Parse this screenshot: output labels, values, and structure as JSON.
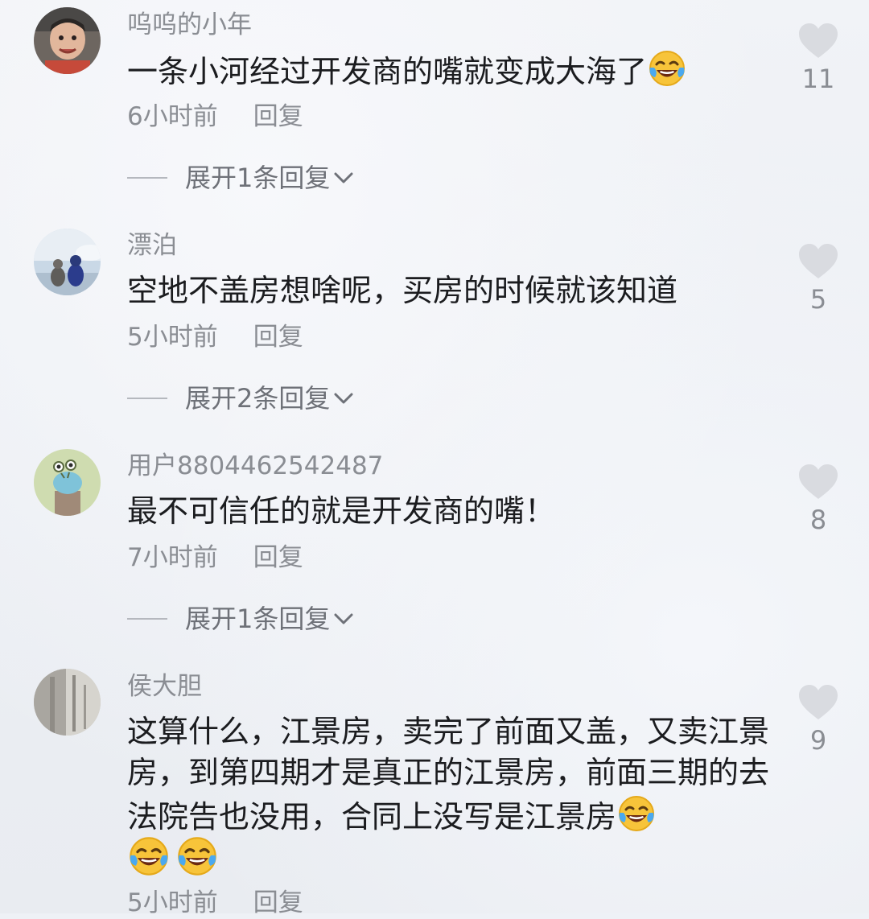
{
  "comments": [
    {
      "username": "呜呜的小年",
      "text": "一条小河经过开发商的嘴就变成大海了",
      "time": "6小时前",
      "reply_label": "回复",
      "expand_label": "展开1条回复",
      "likes": "11",
      "emoji_inline": "laugh-cry-icon"
    },
    {
      "username": "漂泊",
      "text": "空地不盖房想啥呢，买房的时候就该知道",
      "time": "5小时前",
      "reply_label": "回复",
      "expand_label": "展开2条回复",
      "likes": "5"
    },
    {
      "username": "用户8804462542487",
      "text": "最不可信任的就是开发商的嘴！",
      "time": "7小时前",
      "reply_label": "回复",
      "expand_label": "展开1条回复",
      "likes": "8"
    },
    {
      "username": "侯大胆",
      "text": "这算什么，江景房，卖完了前面又盖，又卖江景房，到第四期才是真正的江景房，前面三期的去法院告也没用，合同上没写是江景房",
      "time": "5小时前",
      "reply_label": "回复",
      "likes": "9",
      "emoji_trailing": [
        "laugh-cry-icon",
        "laugh-cry-icon",
        "laugh-cry-icon"
      ]
    }
  ],
  "colors": {
    "background": "#eef1f6",
    "text": "#1b1c1f",
    "secondary": "#8a8d93",
    "heart": "#d9dbe0"
  }
}
